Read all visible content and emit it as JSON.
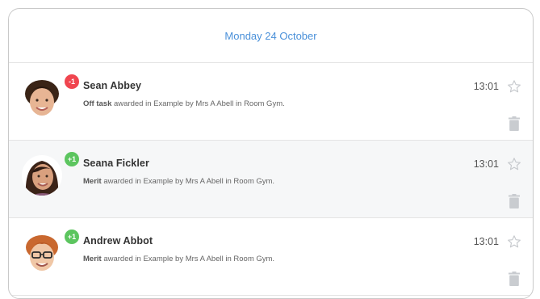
{
  "date_header": "Monday 24 October",
  "rows": [
    {
      "name": "Sean Abbey",
      "badge": "-1",
      "badge_color": "#f0454f",
      "behaviour": "Off task",
      "description": " awarded in Example by Mrs A Abell in Room Gym.",
      "time": "13:01"
    },
    {
      "name": "Seana Fickler",
      "badge": "+1",
      "badge_color": "#5cc55f",
      "behaviour": "Merit",
      "description": " awarded in Example by Mrs A Abell in Room Gym.",
      "time": "13:01"
    },
    {
      "name": "Andrew Abbot",
      "badge": "+1",
      "badge_color": "#5cc55f",
      "behaviour": "Merit",
      "description": " awarded in Example by Mrs A Abell in Room Gym.",
      "time": "13:01"
    }
  ],
  "icons": {
    "favourite": "star-outline-icon",
    "delete": "trash-icon"
  }
}
